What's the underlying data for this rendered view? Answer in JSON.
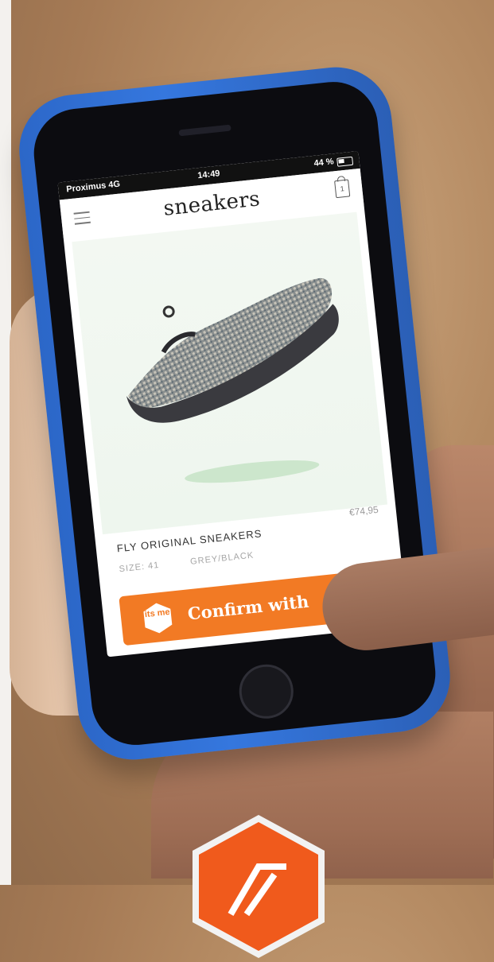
{
  "status_bar": {
    "carrier": "Proximus 4G",
    "time": "14:49",
    "battery": "44 %"
  },
  "app": {
    "title": "sneakers",
    "cart_count": "1"
  },
  "product": {
    "name": "FLY ORIGINAL SNEAKERS",
    "price": "€74,95",
    "size": "SIZE: 41",
    "color": "GREY/BLACK"
  },
  "action": {
    "logo_text": "its me",
    "confirm_label": "Confirm with"
  },
  "colors": {
    "accent": "#f27a24",
    "case_blue": "#3577de"
  }
}
